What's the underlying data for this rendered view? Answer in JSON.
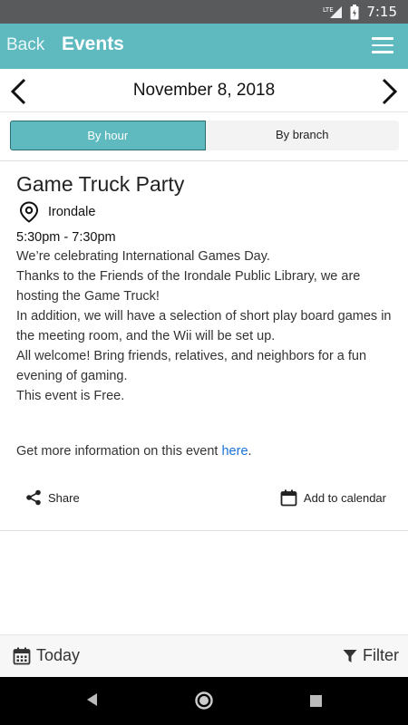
{
  "status_bar": {
    "network": "LTE",
    "time": "7:15"
  },
  "app_bar": {
    "back_label": "Back",
    "title": "Events"
  },
  "date_nav": {
    "date": "November 8, 2018"
  },
  "view_toggle": {
    "by_hour": "By hour",
    "by_branch": "By branch",
    "selected": "By hour"
  },
  "event": {
    "title": "Game Truck Party",
    "location": "Irondale",
    "time": "5:30pm - 7:30pm",
    "description": [
      "We’re celebrating International Games Day.",
      "Thanks to the Friends of the Irondale Public Library, we are hosting the Game Truck!",
      "In addition, we will have a selection of short play board games in the meeting room, and the Wii will be set up.",
      "All welcome! Bring friends, relatives, and neighbors for a fun evening of gaming.",
      "This event is Free."
    ],
    "more_info_prefix": "Get more information on this event ",
    "more_info_link": "here",
    "more_info_suffix": "."
  },
  "actions": {
    "share": "Share",
    "add_to_calendar": "Add to calendar"
  },
  "bottom_bar": {
    "today": "Today",
    "filter": "Filter"
  },
  "colors": {
    "accent": "#5fbac0",
    "link": "#1a73d9"
  }
}
